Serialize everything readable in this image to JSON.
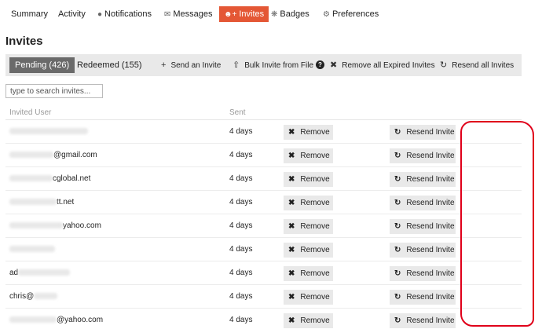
{
  "nav": {
    "items": [
      {
        "label": "Summary",
        "icon": ""
      },
      {
        "label": "Activity",
        "icon": ""
      },
      {
        "label": "Notifications",
        "icon": "speech-bubble-icon"
      },
      {
        "label": "Messages",
        "icon": "envelope-icon"
      },
      {
        "label": "Invites",
        "icon": "user-plus-icon",
        "active": true
      },
      {
        "label": "Badges",
        "icon": "gear-badge-icon"
      },
      {
        "label": "Preferences",
        "icon": "gear-icon"
      }
    ]
  },
  "page": {
    "title": "Invites"
  },
  "tabs": {
    "pending": "Pending (426)",
    "redeemed": "Redeemed (155)"
  },
  "actions": {
    "send": "Send an Invite",
    "bulk": "Bulk Invite from File",
    "help": "?",
    "remove_expired": "Remove all Expired Invites",
    "resend_all": "Resend all Invites"
  },
  "search": {
    "placeholder": "type to search invites..."
  },
  "table": {
    "columns": [
      "Invited User",
      "Sent"
    ],
    "rows": [
      {
        "user": "",
        "sent": "4 days"
      },
      {
        "user": "@gmail.com",
        "sent": "4 days"
      },
      {
        "user": "cglobal.net",
        "sent": "4 days"
      },
      {
        "user": "tt.net",
        "sent": "4 days"
      },
      {
        "user": "yahoo.com",
        "sent": "4 days"
      },
      {
        "user": "",
        "sent": "4 days"
      },
      {
        "user": "ad",
        "sent": "4 days"
      },
      {
        "user": "chris@",
        "sent": "4 days"
      },
      {
        "user": "@yahoo.com",
        "sent": "4 days"
      }
    ],
    "remove_label": "Remove",
    "resend_label": "Resend Invite"
  },
  "colors": {
    "accent": "#e45735",
    "annotation": "#e0001a",
    "tab_active_bg": "#6a6a6a"
  }
}
